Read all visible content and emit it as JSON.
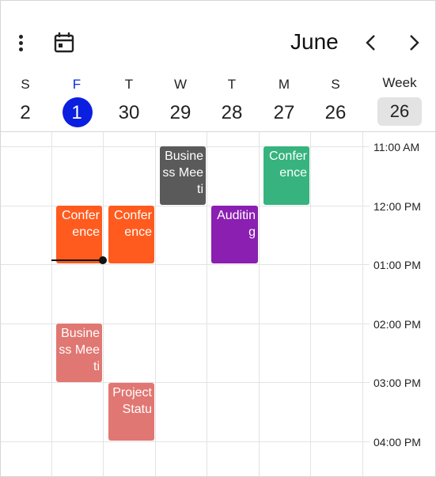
{
  "header": {
    "month": "June",
    "icons": {
      "menu": "more-vertical-icon",
      "calendar": "calendar-icon",
      "prev": "chevron-left-icon",
      "next": "chevron-right-icon"
    }
  },
  "days": [
    {
      "dow": "S",
      "num": "2"
    },
    {
      "dow": "F",
      "num": "1"
    },
    {
      "dow": "T",
      "num": "30"
    },
    {
      "dow": "W",
      "num": "29"
    },
    {
      "dow": "T",
      "num": "28"
    },
    {
      "dow": "M",
      "num": "27"
    },
    {
      "dow": "S",
      "num": "26"
    }
  ],
  "week": {
    "label": "Week",
    "number": "26"
  },
  "times": [
    "11:00 AM",
    "12:00 PM",
    "01:00 PM",
    "02:00 PM",
    "03:00 PM",
    "04:00 PM"
  ],
  "appointments": [
    {
      "subject": "Business Meeting",
      "visible_text": "Business Meeti",
      "color": "#5a5a5a"
    },
    {
      "subject": "Conference",
      "visible_text": "Conference",
      "color": "#36b37e"
    },
    {
      "subject": "Conference",
      "visible_text": "Conference",
      "color": "#ff5b1e"
    },
    {
      "subject": "Conference",
      "visible_text": "Conference",
      "color": "#ff5b1e"
    },
    {
      "subject": "Auditing",
      "visible_text": "Auditing",
      "color": "#8a1fb1"
    },
    {
      "subject": "Business Meeting",
      "visible_text": "Business Meeti",
      "color": "#e17772"
    },
    {
      "subject": "Project Status",
      "visible_text": "Project Statu",
      "color": "#e17772"
    }
  ],
  "colors": {
    "today": "#0a1fe0",
    "today_text": "#0a2bd6",
    "grid": "#e3e3e3",
    "week_badge": "#e3e3e3"
  }
}
